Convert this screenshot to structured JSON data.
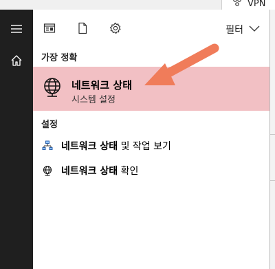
{
  "background": {
    "vpn_label": "VPN",
    "icons": [
      "vpn-icon"
    ]
  },
  "rail": {
    "items": [
      {
        "name": "menu-icon"
      },
      {
        "name": "home-icon"
      }
    ]
  },
  "toolbar": {
    "icons": [
      "apps-icon",
      "document-icon",
      "gear-icon"
    ],
    "filter_label": "필터"
  },
  "sections": {
    "best_match_label": "가장 정확",
    "settings_label": "설정"
  },
  "best_match": {
    "icon": "network-globe-icon",
    "title": "네트워크 상태",
    "subtitle": "시스템 설정"
  },
  "results": [
    {
      "icon": "network-share-icon",
      "bold": "네트워크 상태",
      "rest": " 및 작업 보기"
    },
    {
      "icon": "network-globe-icon",
      "bold": "네트워크 상태",
      "rest": " 확인"
    }
  ],
  "colors": {
    "highlight": "#f2c0c4",
    "rail": "#1f1f1f",
    "arrow": "#f07c5a"
  }
}
